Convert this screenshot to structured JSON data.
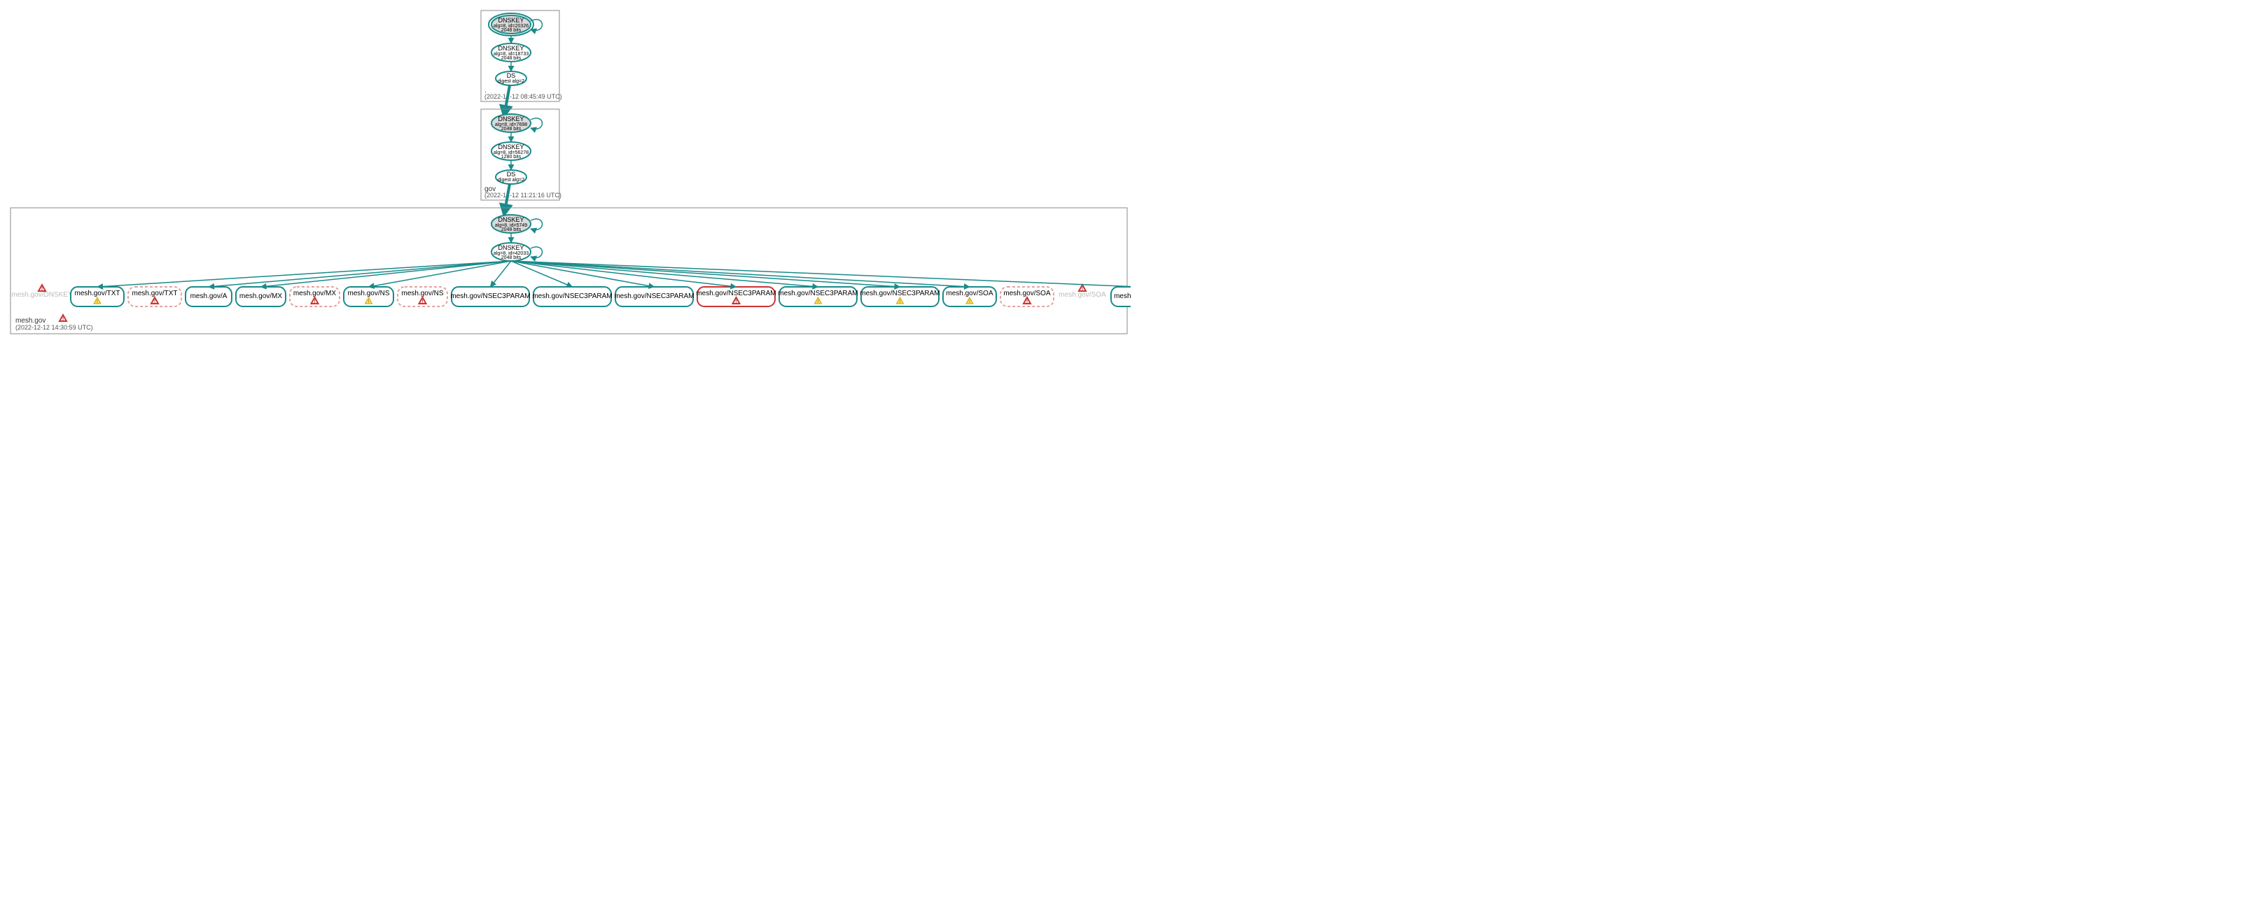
{
  "zones": {
    "root": {
      "label": ".",
      "timestamp": "(2022-12-12 08:45:49 UTC)",
      "ksk": {
        "title": "DNSKEY",
        "sub1": "alg=8, id=20326",
        "sub2": "2048 bits"
      },
      "zsk": {
        "title": "DNSKEY",
        "sub1": "alg=8, id=18733",
        "sub2": "2048 bits"
      },
      "ds": {
        "title": "DS",
        "sub1": "digest alg=2"
      }
    },
    "gov": {
      "label": "gov",
      "timestamp": "(2022-12-12 11:21:16 UTC)",
      "ksk": {
        "title": "DNSKEY",
        "sub1": "alg=8, id=7698",
        "sub2": "2048 bits"
      },
      "zsk": {
        "title": "DNSKEY",
        "sub1": "alg=8, id=56278",
        "sub2": "1280 bits"
      },
      "ds": {
        "title": "DS",
        "sub1": "digest alg=2"
      }
    },
    "mesh": {
      "label": "mesh.gov",
      "timestamp": "(2022-12-12 14:30:59 UTC)",
      "ksk": {
        "title": "DNSKEY",
        "sub1": "alg=8, id=5749",
        "sub2": "2048 bits"
      },
      "zsk": {
        "title": "DNSKEY",
        "sub1": "alg=8, id=42033",
        "sub2": "2048 bits"
      }
    }
  },
  "rrsets": [
    {
      "label": "mesh.gov/DNSKEY",
      "style": "ghost",
      "icon": "error"
    },
    {
      "label": "mesh.gov/TXT",
      "style": "normal",
      "icon": "warning"
    },
    {
      "label": "mesh.gov/TXT",
      "style": "dashed",
      "icon": "error"
    },
    {
      "label": "mesh.gov/A",
      "style": "normal",
      "icon": "none"
    },
    {
      "label": "mesh.gov/MX",
      "style": "normal",
      "icon": "none"
    },
    {
      "label": "mesh.gov/MX",
      "style": "dashed",
      "icon": "error"
    },
    {
      "label": "mesh.gov/NS",
      "style": "normal",
      "icon": "warning"
    },
    {
      "label": "mesh.gov/NS",
      "style": "dashed",
      "icon": "error"
    },
    {
      "label": "mesh.gov/NSEC3PARAM",
      "style": "normal",
      "icon": "none"
    },
    {
      "label": "mesh.gov/NSEC3PARAM",
      "style": "normal",
      "icon": "none"
    },
    {
      "label": "mesh.gov/NSEC3PARAM",
      "style": "normal",
      "icon": "none"
    },
    {
      "label": "mesh.gov/NSEC3PARAM",
      "style": "error",
      "icon": "error"
    },
    {
      "label": "mesh.gov/NSEC3PARAM",
      "style": "normal",
      "icon": "warning"
    },
    {
      "label": "mesh.gov/NSEC3PARAM",
      "style": "normal",
      "icon": "warning"
    },
    {
      "label": "mesh.gov/SOA",
      "style": "normal",
      "icon": "warning"
    },
    {
      "label": "mesh.gov/SOA",
      "style": "dashed",
      "icon": "error"
    },
    {
      "label": "mesh.gov/SOA",
      "style": "ghost",
      "icon": "error"
    },
    {
      "label": "mesh.gov/AAAA",
      "style": "normal",
      "icon": "none"
    }
  ],
  "footer_icon": "error"
}
